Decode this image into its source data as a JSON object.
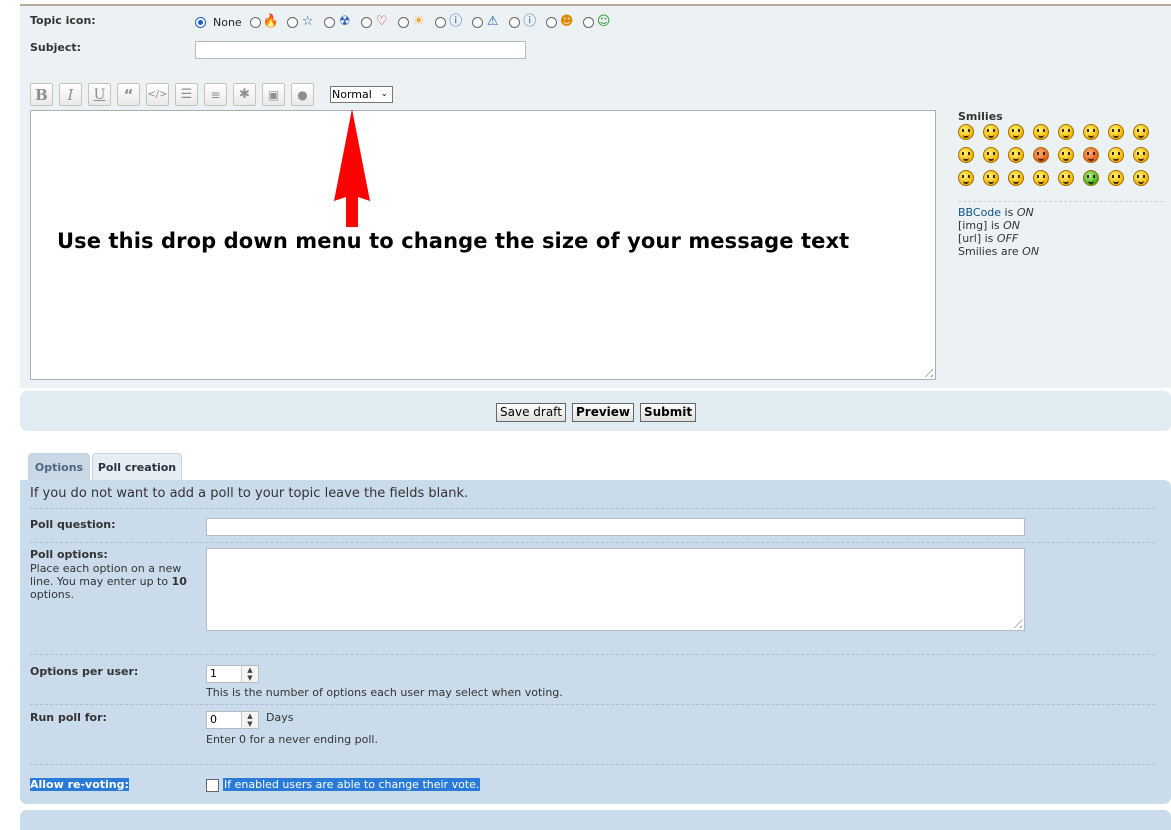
{
  "topic_icon": {
    "label": "Topic icon:",
    "none_label": "None",
    "icons": [
      "fire-icon",
      "star-icon",
      "radioactive-icon",
      "heart-icon",
      "sun-icon",
      "question-icon",
      "warning-icon",
      "info-icon",
      "smiley-icon",
      "grin-icon"
    ]
  },
  "subject": {
    "label": "Subject:",
    "value": ""
  },
  "toolbar": {
    "bold": "B",
    "italic": "I",
    "underline": "U",
    "size_value": "Normal"
  },
  "annotation": {
    "text": "Use this drop down menu to change the size of your message text"
  },
  "smilies": {
    "title": "Smilies",
    "bbcode_link": "BBCode",
    "bbcode_is": " is ",
    "bbcode_state": "ON",
    "img_label": "[img] is ",
    "img_state": "ON",
    "url_label": "[url] is ",
    "url_state": "OFF",
    "smilies_label": "Smilies are ",
    "smilies_state": "ON"
  },
  "buttons": {
    "save_draft": "Save draft",
    "preview": "Preview",
    "submit": "Submit"
  },
  "tabs": {
    "options": "Options",
    "poll_creation": "Poll creation"
  },
  "poll": {
    "intro": "If you do not want to add a poll to your topic leave the fields blank.",
    "question_label": "Poll question:",
    "question_value": "",
    "options_label": "Poll options:",
    "options_desc_1": "Place each option on a new line. You may enter up to ",
    "options_desc_max": "10",
    "options_desc_2": " options.",
    "per_user_label": "Options per user:",
    "per_user_value": "1",
    "per_user_hint": "This is the number of options each user may select when voting.",
    "run_for_label": "Run poll for:",
    "run_for_value": "0",
    "run_for_unit": "Days",
    "run_for_hint": "Enter 0 for a never ending poll.",
    "revote_label": "Allow re-voting:",
    "revote_hint": "If enabled users are able to change their vote."
  }
}
